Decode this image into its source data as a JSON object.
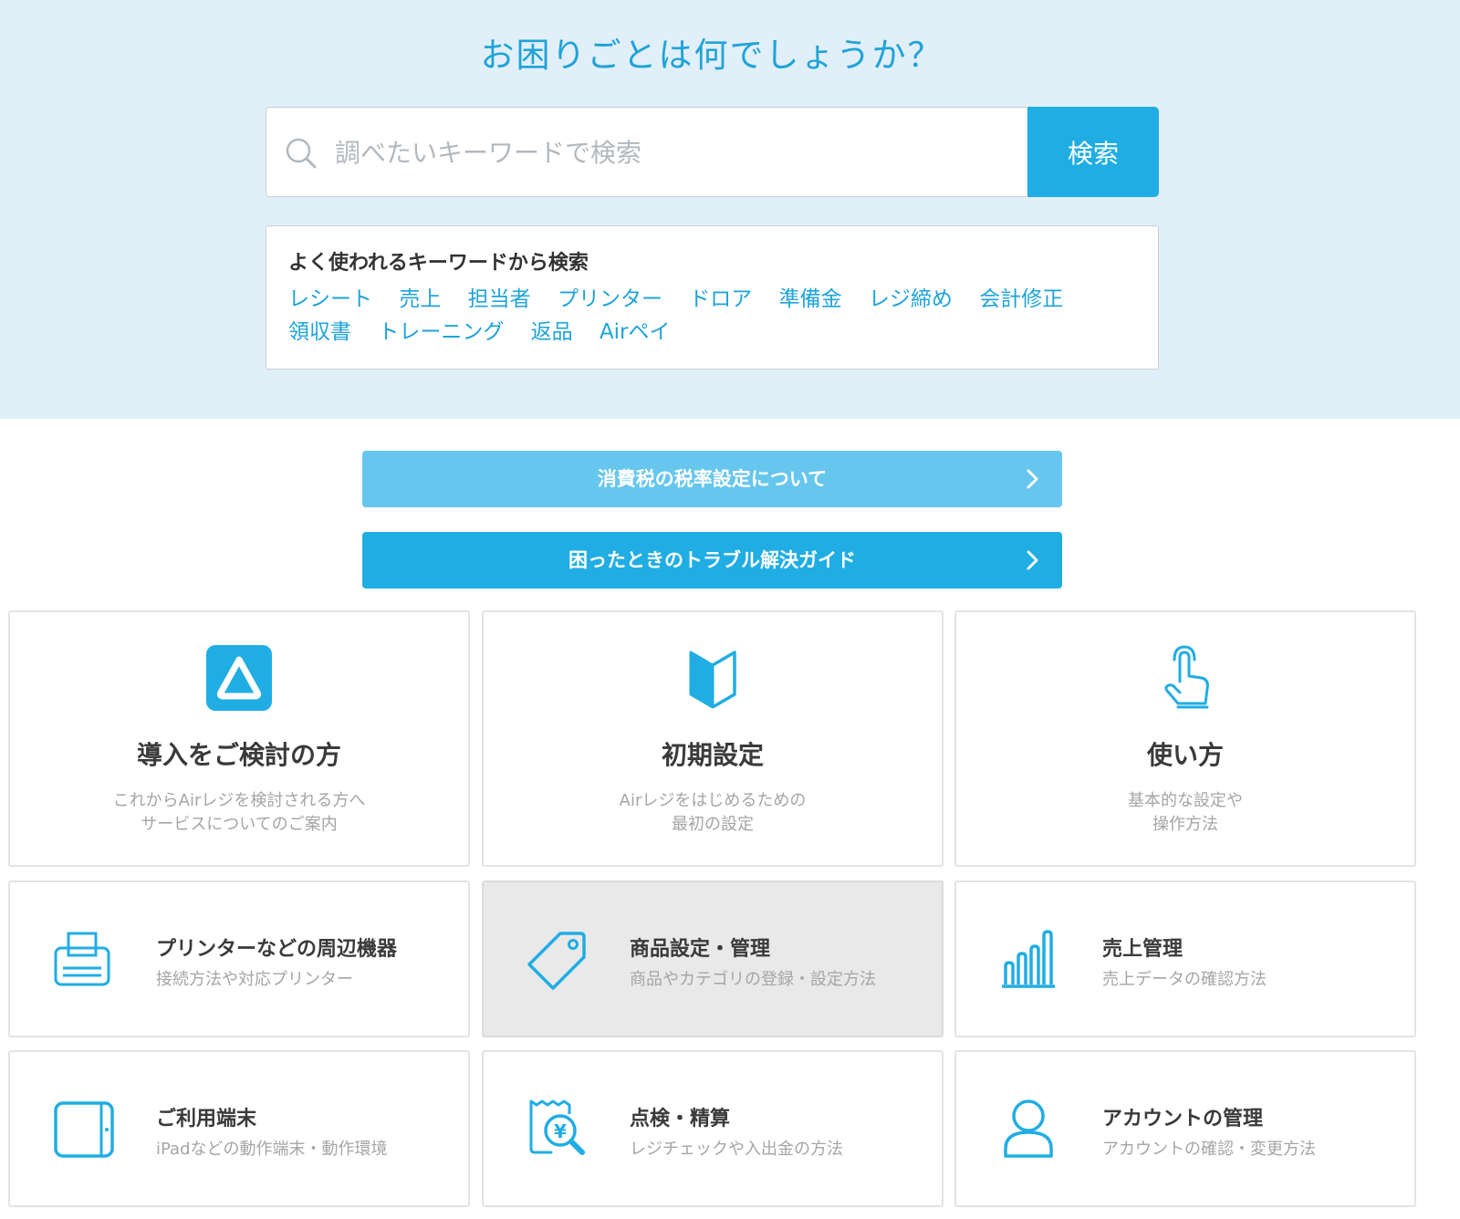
{
  "hero": {
    "title": "お困りごとは何でしょうか？",
    "search": {
      "placeholder": "調べたいキーワードで検索",
      "button_label": "検索"
    },
    "keywords": {
      "heading": "よく使われるキーワードから検索",
      "items": [
        "レシート",
        "売上",
        "担当者",
        "プリンター",
        "ドロア",
        "準備金",
        "レジ締め",
        "会計修正",
        "領収書",
        "トレーニング",
        "返品",
        "Airペイ"
      ]
    }
  },
  "banners": [
    {
      "label": "消費税の税率設定について",
      "color": "#66c6ed"
    },
    {
      "label": "困ったときのトラブル解決ガイド",
      "color": "#20ade3"
    }
  ],
  "cards": [
    {
      "title": "導入をご検討の方",
      "desc1": "これからAirレジを検討される方へ",
      "desc2": "サービスについてのご案内",
      "icon": "airregi-logo-icon"
    },
    {
      "title": "初期設定",
      "desc1": "Airレジをはじめるための",
      "desc2": "最初の設定",
      "icon": "beginner-mark-icon"
    },
    {
      "title": "使い方",
      "desc1": "基本的な設定や",
      "desc2": "操作方法",
      "icon": "tap-hand-icon"
    },
    {
      "title": "プリンターなどの周辺機器",
      "desc": "接続方法や対応プリンター",
      "icon": "printer-icon"
    },
    {
      "title": "商品設定・管理",
      "desc": "商品やカテゴリの登録・設定方法",
      "icon": "price-tag-icon",
      "state": "hover"
    },
    {
      "title": "売上管理",
      "desc": "売上データの確認方法",
      "icon": "bar-chart-icon"
    },
    {
      "title": "ご利用端末",
      "desc": "iPadなどの動作端末・動作環境",
      "icon": "tablet-icon"
    },
    {
      "title": "点検・精算",
      "desc": "レジチェックや入出金の方法",
      "icon": "receipt-yen-search-icon"
    },
    {
      "title": "アカウントの管理",
      "desc": "アカウントの確認・変更方法",
      "icon": "user-account-icon"
    }
  ],
  "colors": {
    "accent": "#20ade3",
    "accent_light": "#66c6ed",
    "hero_bg": "#e1eff8",
    "active_card_bg": "#e9e9e9"
  }
}
